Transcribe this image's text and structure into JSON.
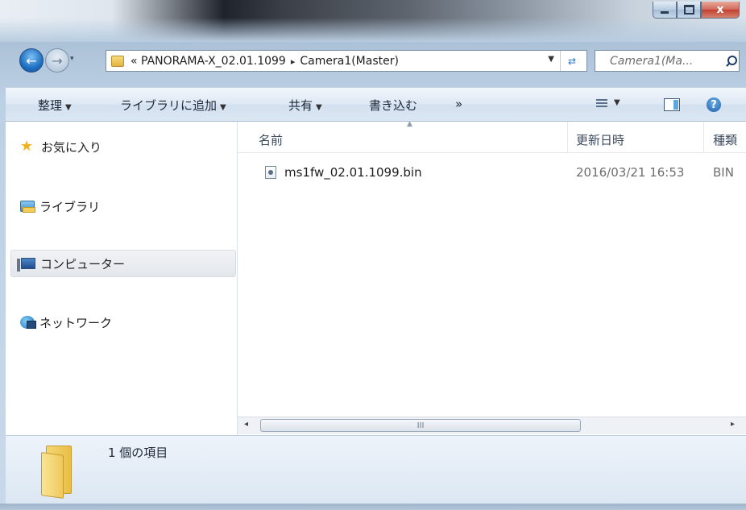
{
  "window": {
    "caption": {
      "minimize": "–",
      "maximize": "□",
      "close": "x"
    }
  },
  "address": {
    "overflow": "«",
    "path": [
      "PANORAMA-X_02.01.1099",
      "Camera1(Master)"
    ],
    "separator": "▸"
  },
  "search": {
    "placeholder": "Camera1(Ma..."
  },
  "toolbar": {
    "organize": "整理",
    "add_to_library": "ライブラリに追加",
    "share": "共有",
    "burn": "書き込む",
    "more": "»",
    "help": "?"
  },
  "nav": {
    "items": [
      {
        "label": "お気に入り",
        "icon": "star-icon"
      },
      {
        "label": "ライブラリ",
        "icon": "library-icon"
      },
      {
        "label": "コンピューター",
        "icon": "computer-icon",
        "selected": true
      },
      {
        "label": "ネットワーク",
        "icon": "network-icon"
      }
    ]
  },
  "columns": {
    "name": "名前",
    "modified": "更新日時",
    "type": "種類"
  },
  "files": [
    {
      "name": "ms1fw_02.01.1099.bin",
      "modified": "2016/03/21 16:53",
      "type": "BIN"
    }
  ],
  "scrollbar": {
    "thumb_grip": "III",
    "left_arrow": "◂",
    "right_arrow": "▸"
  },
  "details": {
    "item_count": "1 個の項目"
  },
  "colors": {
    "accent": "#1d6fc2",
    "folder": "#e9be45",
    "close_button": "#c0402f"
  }
}
